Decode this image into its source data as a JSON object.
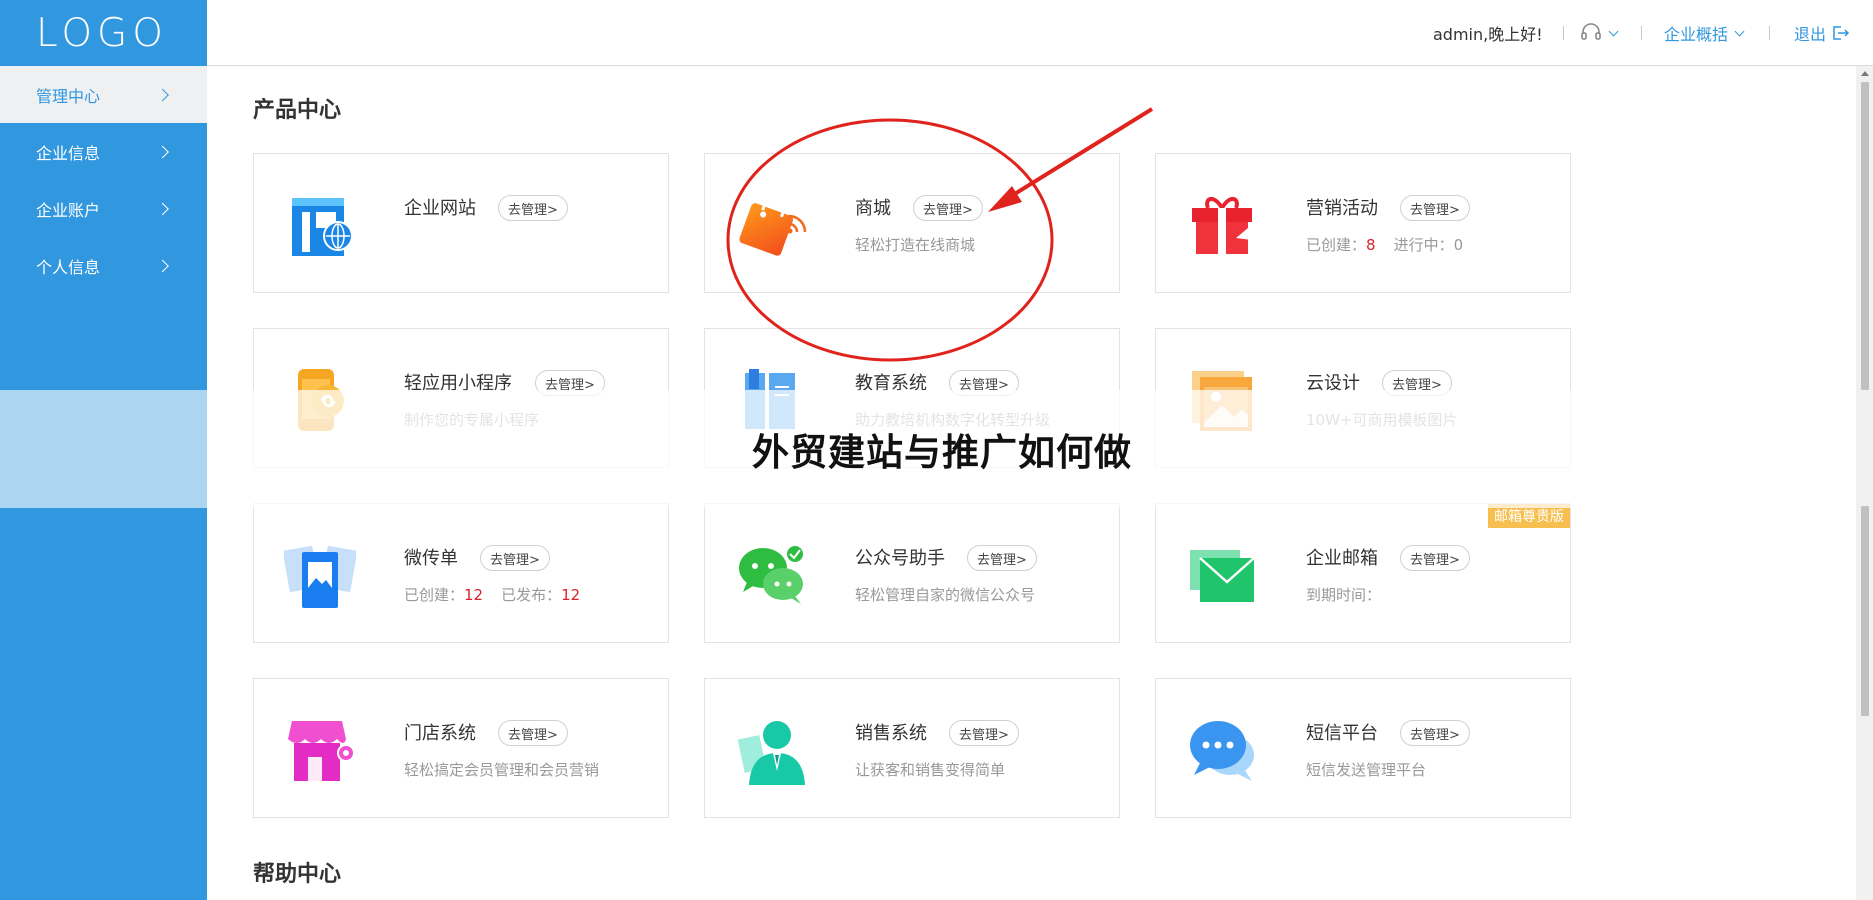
{
  "logo": "LOGO",
  "sidebar": {
    "items": [
      {
        "label": "管理中心",
        "active": true
      },
      {
        "label": "企业信息"
      },
      {
        "label": "企业账户"
      },
      {
        "label": "个人信息"
      }
    ]
  },
  "header": {
    "greeting": "admin,晚上好!",
    "support_icon": "headset-icon",
    "overview_label": "企业概括",
    "logout_label": "退出",
    "logout_icon": "logout-icon"
  },
  "sections": {
    "products_title": "产品中心",
    "help_title": "帮助中心"
  },
  "manage_label": "去管理>",
  "cards": [
    {
      "name": "企业网站",
      "desc": "",
      "icon": "website-icon"
    },
    {
      "name": "商城",
      "desc": "轻松打造在线商城",
      "icon": "shopping-bag-icon"
    },
    {
      "name": "营销活动",
      "created_label": "已创建：",
      "created": "8",
      "ongoing_label": "进行中：",
      "ongoing": "0",
      "icon": "gift-icon"
    },
    {
      "name": "轻应用小程序",
      "desc": "制作您的专属小程序",
      "icon": "mini-program-icon"
    },
    {
      "name": "教育系统",
      "desc": "助力教培机构数字化转型升级",
      "icon": "book-icon"
    },
    {
      "name": "云设计",
      "desc": "10W+可商用模板图片",
      "icon": "image-template-icon"
    },
    {
      "name": "微传单",
      "created_label": "已创建：",
      "created": "12",
      "published_label": "已发布：",
      "published": "12",
      "icon": "flyer-icon"
    },
    {
      "name": "公众号助手",
      "desc": "轻松管理自家的微信公众号",
      "icon": "wechat-icon"
    },
    {
      "name": "企业邮箱",
      "desc": "到期时间：",
      "badge": "邮箱尊贵版",
      "icon": "mail-icon"
    },
    {
      "name": "门店系统",
      "desc": "轻松搞定会员管理和会员营销",
      "icon": "store-icon"
    },
    {
      "name": "销售系统",
      "desc": "让获客和销售变得简单",
      "icon": "salesperson-icon"
    },
    {
      "name": "短信平台",
      "desc": "短信发送管理平台",
      "icon": "sms-chat-icon"
    }
  ],
  "overlay_title": "外贸建站与推广如何做",
  "colors": {
    "sidebar": "#3197df",
    "accent": "#3197df",
    "annotation": "#e0231c",
    "highlight_number": "#d9232d",
    "vip_badge": "#f6bf4f"
  }
}
